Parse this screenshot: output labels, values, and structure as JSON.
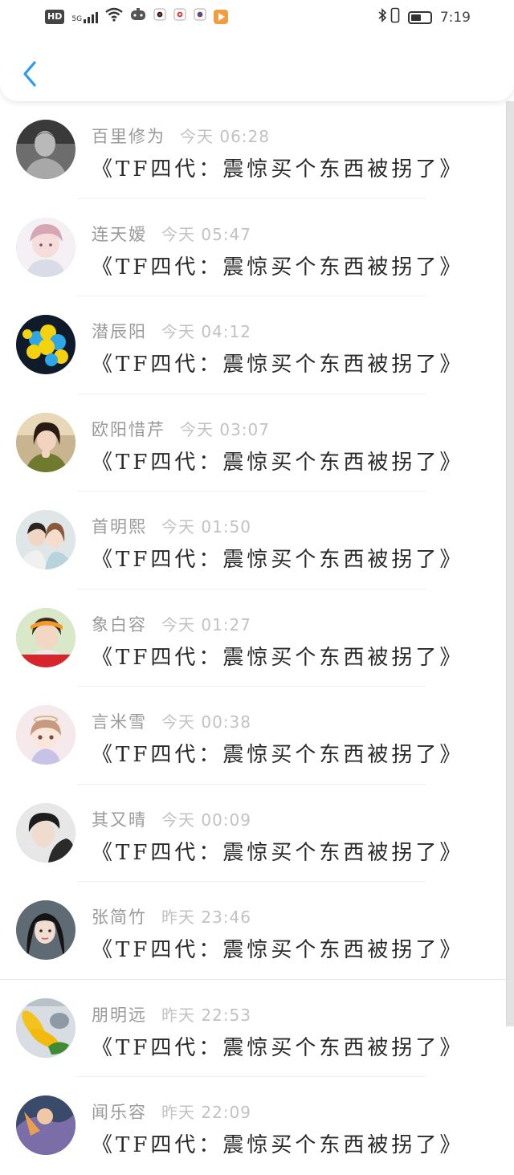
{
  "status_bar": {
    "hd": "HD",
    "network": "5G",
    "clock": "7:19"
  },
  "message_prefix": "《TF四代：",
  "messages": [
    {
      "name": "百里修为",
      "time": "今天 06:28",
      "text": "《TF四代：震惊买个东西被拐了》"
    },
    {
      "name": "连天嫒",
      "time": "今天 05:47",
      "text": "《TF四代：震惊买个东西被拐了》"
    },
    {
      "name": "潜辰阳",
      "time": "今天 04:12",
      "text": "《TF四代：震惊买个东西被拐了》"
    },
    {
      "name": "欧阳惜芹",
      "time": "今天 03:07",
      "text": "《TF四代：震惊买个东西被拐了》"
    },
    {
      "name": "首明熙",
      "time": "今天 01:50",
      "text": "《TF四代：震惊买个东西被拐了》"
    },
    {
      "name": "象白容",
      "time": "今天 01:27",
      "text": "《TF四代：震惊买个东西被拐了》"
    },
    {
      "name": "言米雪",
      "time": "今天 00:38",
      "text": "《TF四代：震惊买个东西被拐了》"
    },
    {
      "name": "其又晴",
      "time": "今天 00:09",
      "text": "《TF四代：震惊买个东西被拐了》"
    },
    {
      "name": "张简竹",
      "time": "昨天 23:46",
      "text": "《TF四代：震惊买个东西被拐了》"
    },
    {
      "name": "朋明远",
      "time": "昨天 22:53",
      "text": "《TF四代：震惊买个东西被拐了》"
    },
    {
      "name": "闻乐容",
      "time": "昨天 22:09",
      "text": "《TF四代：震惊买个东西被拐了》"
    }
  ],
  "colors": {
    "accent": "#2b9af3",
    "name": "#9a9a9a",
    "time": "#c2c2c2",
    "message": "#2a2a2a"
  },
  "icons": {
    "back": "chevron-left-icon",
    "wifi": "wifi-icon",
    "bluetooth": "bluetooth-icon",
    "vibrate": "vibrate-icon",
    "battery": "battery-icon"
  }
}
